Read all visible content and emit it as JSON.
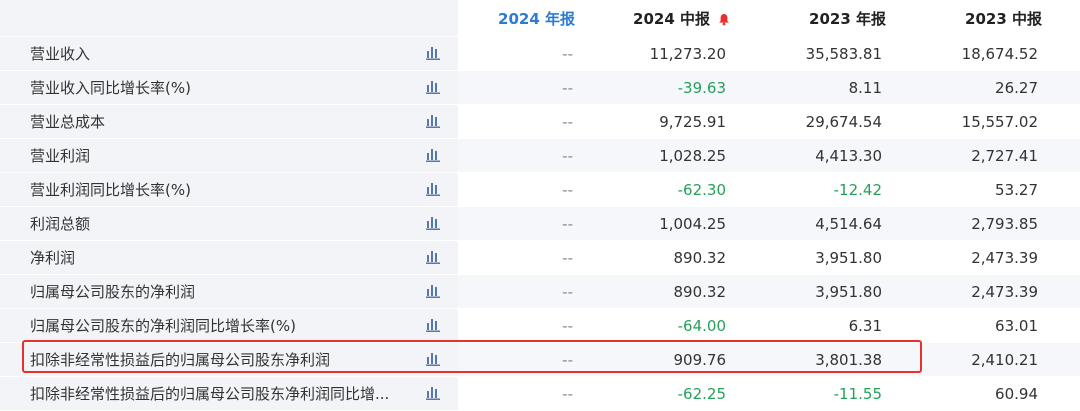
{
  "columns": [
    "2024 年报",
    "2024 中报",
    "2023 年报",
    "2023 中报"
  ],
  "colors": {
    "header_active": "#2b7cd3",
    "negative": "#26a05a",
    "highlight_border": "#e8312c",
    "bell": "#e8312c",
    "icon": "#5577aa"
  },
  "icons": {
    "row_chart": "bar-chart-icon",
    "report_alert": "bell-icon"
  },
  "rows": [
    {
      "label": "营业收入",
      "values": [
        "--",
        "11,273.20",
        "35,583.81",
        "18,674.52"
      ]
    },
    {
      "label": "营业收入同比增长率(%)",
      "values": [
        "--",
        "-39.63",
        "8.11",
        "26.27"
      ]
    },
    {
      "label": "营业总成本",
      "values": [
        "--",
        "9,725.91",
        "29,674.54",
        "15,557.02"
      ]
    },
    {
      "label": "营业利润",
      "values": [
        "--",
        "1,028.25",
        "4,413.30",
        "2,727.41"
      ]
    },
    {
      "label": "营业利润同比增长率(%)",
      "values": [
        "--",
        "-62.30",
        "-12.42",
        "53.27"
      ]
    },
    {
      "label": "利润总额",
      "values": [
        "--",
        "1,004.25",
        "4,514.64",
        "2,793.85"
      ]
    },
    {
      "label": "净利润",
      "values": [
        "--",
        "890.32",
        "3,951.80",
        "2,473.39"
      ]
    },
    {
      "label": "归属母公司股东的净利润",
      "values": [
        "--",
        "890.32",
        "3,951.80",
        "2,473.39"
      ]
    },
    {
      "label": "归属母公司股东的净利润同比增长率(%)",
      "values": [
        "--",
        "-64.00",
        "6.31",
        "63.01"
      ]
    },
    {
      "label": "扣除非经常性损益后的归属母公司股东净利润",
      "values": [
        "--",
        "909.76",
        "3,801.38",
        "2,410.21"
      ],
      "highlighted": true
    },
    {
      "label": "扣除非经常性损益后的归属母公司股东净利润同比增...",
      "values": [
        "--",
        "-62.25",
        "-11.55",
        "60.94"
      ]
    }
  ]
}
